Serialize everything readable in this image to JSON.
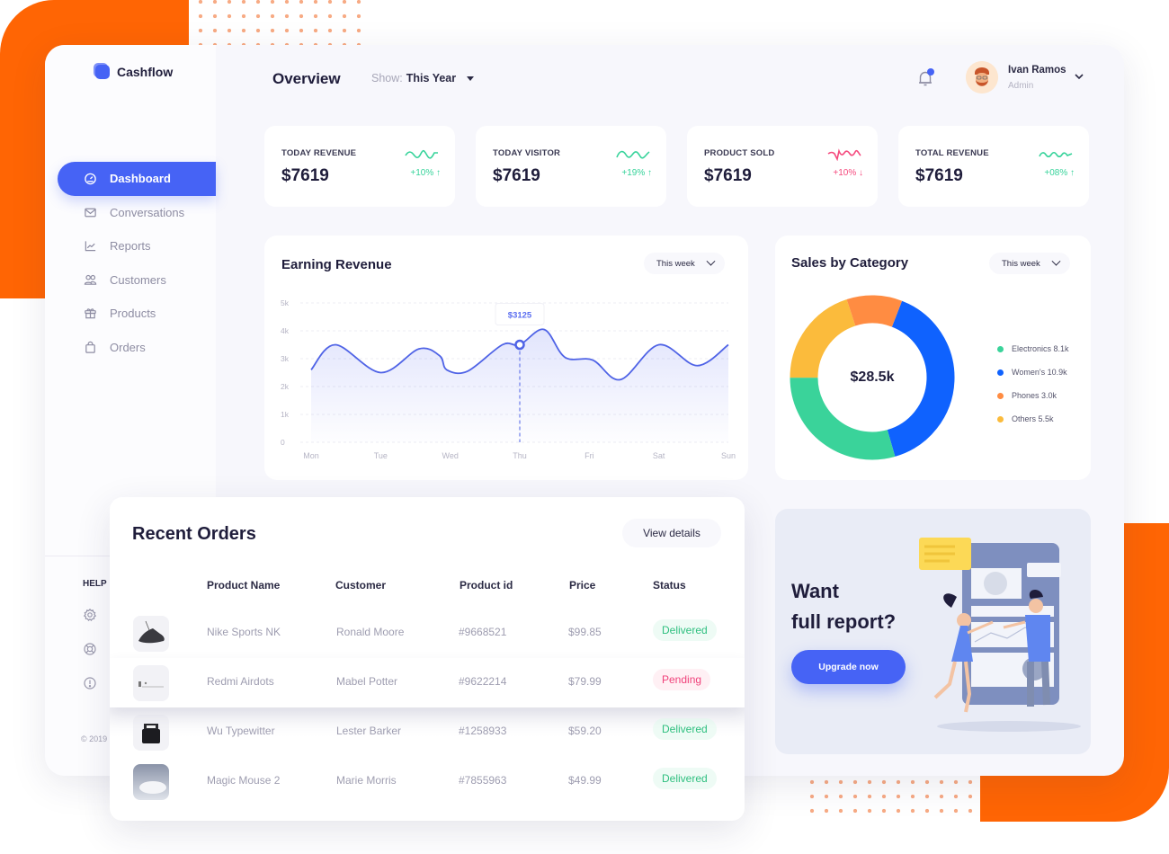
{
  "app": {
    "brand": "Cashflow",
    "page_title": "Overview",
    "show_filter": {
      "label": "Show:",
      "value": "This Year"
    },
    "user": {
      "name": "Ivan Ramos",
      "role": "Admin"
    },
    "accent": "#4663f5"
  },
  "sidebar": {
    "items": [
      {
        "label": "Dashboard",
        "icon": "dashboard-gauge-icon",
        "active": true
      },
      {
        "label": "Conversations",
        "icon": "mail-icon",
        "active": false
      },
      {
        "label": "Reports",
        "icon": "chart-line-icon",
        "active": false
      },
      {
        "label": "Customers",
        "icon": "users-icon",
        "active": false
      },
      {
        "label": "Products",
        "icon": "gift-box-icon",
        "active": false
      },
      {
        "label": "Orders",
        "icon": "shopping-bag-icon",
        "active": false
      }
    ],
    "help_label": "HELP",
    "help_icons": [
      "settings-icon",
      "lifebuoy-icon",
      "info-icon"
    ],
    "copyright": "© 2019"
  },
  "stats": [
    {
      "label": "TODAY REVENUE",
      "value": "$7619",
      "delta": "+10%",
      "trend": "up"
    },
    {
      "label": "TODAY VISITOR",
      "value": "$7619",
      "delta": "+19%",
      "trend": "up"
    },
    {
      "label": "PRODUCT SOLD",
      "value": "$7619",
      "delta": "+10%",
      "trend": "down"
    },
    {
      "label": "TOTAL REVENUE",
      "value": "$7619",
      "delta": "+08%",
      "trend": "up"
    }
  ],
  "earning": {
    "title": "Earning Revenue",
    "range": "This week",
    "tooltip": "$3125"
  },
  "sales": {
    "title": "Sales by Category",
    "range": "This week",
    "total": "$28.5k"
  },
  "chart_data": [
    {
      "type": "line",
      "title": "Earning Revenue",
      "categories": [
        "Mon",
        "Tue",
        "Wed",
        "Thu",
        "Fri",
        "Sat",
        "Sun"
      ],
      "x": [
        0,
        0.5,
        1,
        1.5,
        2,
        2.5,
        3,
        3.2,
        3.5,
        4,
        4.5,
        5,
        5.5,
        6
      ],
      "values": [
        2600,
        3500,
        2500,
        3400,
        2500,
        3500,
        4100,
        3000,
        3000,
        2250,
        3500,
        2800,
        3500,
        3500
      ],
      "series_points": [
        {
          "x": 0,
          "y": 2600
        },
        {
          "x": 0.35,
          "y": 3500
        },
        {
          "x": 1.0,
          "y": 2500
        },
        {
          "x": 1.55,
          "y": 3350
        },
        {
          "x": 1.85,
          "y": 3100
        },
        {
          "x": 1.95,
          "y": 2600
        },
        {
          "x": 2.25,
          "y": 2550
        },
        {
          "x": 2.75,
          "y": 3500
        },
        {
          "x": 3.0,
          "y": 3500
        },
        {
          "x": 3.35,
          "y": 4050
        },
        {
          "x": 3.65,
          "y": 3050
        },
        {
          "x": 4.05,
          "y": 2950
        },
        {
          "x": 4.45,
          "y": 2250
        },
        {
          "x": 5.0,
          "y": 3500
        },
        {
          "x": 5.55,
          "y": 2750
        },
        {
          "x": 6.0,
          "y": 3500
        }
      ],
      "highlight": {
        "x": 3.0,
        "y": 3500,
        "label": "$3125"
      },
      "yticks": [
        "0",
        "1k",
        "2k",
        "3k",
        "4k",
        "5k"
      ],
      "ylim": [
        0,
        5000
      ],
      "grid": true,
      "fill": "gradient"
    },
    {
      "type": "pie",
      "title": "Sales by Category",
      "center_label": "$28.5k",
      "slices": [
        {
          "name": "Electronics",
          "value": 8.1,
          "label": "Electronics 8.1k",
          "color": "#3ad39a"
        },
        {
          "name": "Women's",
          "value": 10.9,
          "label": "Women's 10.9k",
          "color": "#0f62fe"
        },
        {
          "name": "Phones",
          "value": 3.0,
          "label": "Phones 3.0k",
          "color": "#ff8c42"
        },
        {
          "name": "Others",
          "value": 5.5,
          "label": "Others 5.5k",
          "color": "#fbbb3c"
        }
      ],
      "legend": "right"
    }
  ],
  "orders": {
    "title": "Recent Orders",
    "view_details": "View details",
    "columns": [
      "Product Name",
      "Customer",
      "Product id",
      "Price",
      "Status"
    ],
    "rows": [
      {
        "product": "Nike Sports NK",
        "customer": "Ronald Moore",
        "id": "#9668521",
        "price": "$99.85",
        "status": "Delivered",
        "thumb": "sneaker"
      },
      {
        "product": "Redmi Airdots",
        "customer": "Mabel Potter",
        "id": "#9622214",
        "price": "$79.99",
        "status": "Pending",
        "thumb": "earbuds"
      },
      {
        "product": "Wu Typewitter",
        "customer": "Lester Barker",
        "id": "#1258933",
        "price": "$59.20",
        "status": "Delivered",
        "thumb": "typewriter"
      },
      {
        "product": "Magic Mouse 2",
        "customer": "Marie Morris",
        "id": "#7855963",
        "price": "$49.99",
        "status": "Delivered",
        "thumb": "mouse"
      }
    ]
  },
  "promo": {
    "title_line1": "Want",
    "title_line2": "full report?",
    "button": "Upgrade now"
  }
}
